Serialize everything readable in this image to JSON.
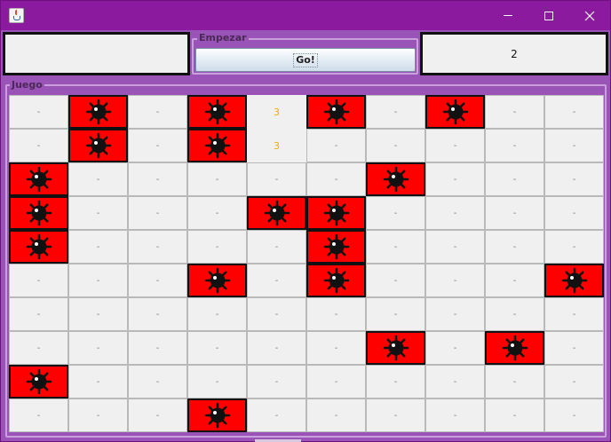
{
  "window": {
    "app_icon": "java-cup-icon",
    "title": ""
  },
  "controls": {
    "minimize_icon": "minimize-icon",
    "maximize_icon": "maximize-icon",
    "close_icon": "close-icon"
  },
  "left_panel": {
    "text": ""
  },
  "empezar": {
    "legend": "Empezar",
    "button_label": "Go!"
  },
  "right_panel": {
    "value": "2"
  },
  "juego": {
    "legend": "Juego"
  },
  "board": {
    "rows": [
      [
        {
          "s": "h",
          "t": "-"
        },
        {
          "s": "m"
        },
        {
          "s": "h",
          "t": "-"
        },
        {
          "s": "m"
        },
        {
          "s": "r",
          "t": "3"
        },
        {
          "s": "m"
        },
        {
          "s": "h",
          "t": "-"
        },
        {
          "s": "m"
        },
        {
          "s": "h",
          "t": "-"
        },
        {
          "s": "h",
          "t": "-"
        }
      ],
      [
        {
          "s": "h",
          "t": "-"
        },
        {
          "s": "m"
        },
        {
          "s": "h",
          "t": "-"
        },
        {
          "s": "m"
        },
        {
          "s": "r",
          "t": "3"
        },
        {
          "s": "h",
          "t": "-"
        },
        {
          "s": "h",
          "t": "-"
        },
        {
          "s": "h",
          "t": "-"
        },
        {
          "s": "h",
          "t": "-"
        },
        {
          "s": "h",
          "t": "-"
        }
      ],
      [
        {
          "s": "m"
        },
        {
          "s": "h",
          "t": "-"
        },
        {
          "s": "h",
          "t": "-"
        },
        {
          "s": "h",
          "t": "-"
        },
        {
          "s": "h",
          "t": "-"
        },
        {
          "s": "h",
          "t": "-"
        },
        {
          "s": "m"
        },
        {
          "s": "h",
          "t": "-"
        },
        {
          "s": "h",
          "t": "-"
        },
        {
          "s": "h",
          "t": "-"
        }
      ],
      [
        {
          "s": "m"
        },
        {
          "s": "h",
          "t": "-"
        },
        {
          "s": "h",
          "t": "-"
        },
        {
          "s": "h",
          "t": "-"
        },
        {
          "s": "m"
        },
        {
          "s": "m"
        },
        {
          "s": "h",
          "t": "-"
        },
        {
          "s": "h",
          "t": "-"
        },
        {
          "s": "h",
          "t": "-"
        },
        {
          "s": "h",
          "t": "-"
        }
      ],
      [
        {
          "s": "m"
        },
        {
          "s": "h",
          "t": "-"
        },
        {
          "s": "h",
          "t": "-"
        },
        {
          "s": "h",
          "t": "-"
        },
        {
          "s": "h",
          "t": "-"
        },
        {
          "s": "m"
        },
        {
          "s": "h",
          "t": "-"
        },
        {
          "s": "h",
          "t": "-"
        },
        {
          "s": "h",
          "t": "-"
        },
        {
          "s": "h",
          "t": "-"
        }
      ],
      [
        {
          "s": "h",
          "t": "-"
        },
        {
          "s": "h",
          "t": "-"
        },
        {
          "s": "h",
          "t": "-"
        },
        {
          "s": "m"
        },
        {
          "s": "h",
          "t": "-"
        },
        {
          "s": "m"
        },
        {
          "s": "h",
          "t": "-"
        },
        {
          "s": "h",
          "t": "-"
        },
        {
          "s": "h",
          "t": "-"
        },
        {
          "s": "m"
        }
      ],
      [
        {
          "s": "h",
          "t": "-"
        },
        {
          "s": "h",
          "t": "-"
        },
        {
          "s": "h",
          "t": "-"
        },
        {
          "s": "h",
          "t": "-"
        },
        {
          "s": "h",
          "t": "-"
        },
        {
          "s": "h",
          "t": "-"
        },
        {
          "s": "h",
          "t": "-"
        },
        {
          "s": "h",
          "t": "-"
        },
        {
          "s": "h",
          "t": "-"
        },
        {
          "s": "h",
          "t": "-"
        }
      ],
      [
        {
          "s": "h",
          "t": "-"
        },
        {
          "s": "h",
          "t": "-"
        },
        {
          "s": "h",
          "t": "-"
        },
        {
          "s": "h",
          "t": "-"
        },
        {
          "s": "h",
          "t": "-"
        },
        {
          "s": "h",
          "t": "-"
        },
        {
          "s": "m"
        },
        {
          "s": "h",
          "t": "-"
        },
        {
          "s": "m"
        },
        {
          "s": "h",
          "t": "-"
        }
      ],
      [
        {
          "s": "m"
        },
        {
          "s": "h",
          "t": "-"
        },
        {
          "s": "h",
          "t": "-"
        },
        {
          "s": "h",
          "t": "-"
        },
        {
          "s": "h",
          "t": "-"
        },
        {
          "s": "h",
          "t": "-"
        },
        {
          "s": "h",
          "t": "-"
        },
        {
          "s": "h",
          "t": "-"
        },
        {
          "s": "h",
          "t": "-"
        },
        {
          "s": "h",
          "t": "-"
        }
      ],
      [
        {
          "s": "h",
          "t": "-"
        },
        {
          "s": "h",
          "t": "-"
        },
        {
          "s": "h",
          "t": "-"
        },
        {
          "s": "m"
        },
        {
          "s": "h",
          "t": "-"
        },
        {
          "s": "h",
          "t": "-"
        },
        {
          "s": "h",
          "t": "-"
        },
        {
          "s": "h",
          "t": "-"
        },
        {
          "s": "h",
          "t": "-"
        },
        {
          "s": "h",
          "t": "-"
        }
      ]
    ],
    "mine_icon": "mine-icon"
  },
  "colors": {
    "titlebar": "#8b1a9e",
    "content_bg": "#9a54b8",
    "mine_bg": "#ff0000",
    "number": "#f0b000",
    "cell_bg": "#f0f0f0"
  }
}
